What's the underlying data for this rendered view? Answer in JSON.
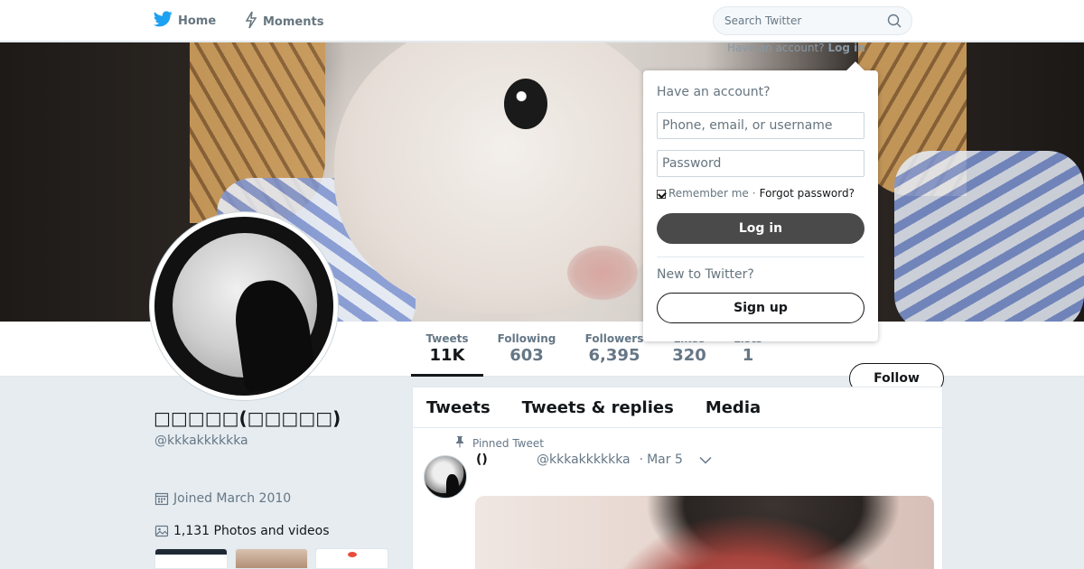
{
  "nav": {
    "home_label": "Home",
    "moments_label": "Moments",
    "search_placeholder": "Search Twitter",
    "account_prompt": "Have an account?",
    "login_link": "Log in"
  },
  "profile": {
    "display_name": "□□□□□(□□□□□)",
    "handle": "@kkkakkkkkka",
    "joined": "Joined March 2010",
    "photos_videos": "1,131 Photos and videos"
  },
  "stats": [
    {
      "label": "Tweets",
      "value": "11K"
    },
    {
      "label": "Following",
      "value": "603"
    },
    {
      "label": "Followers",
      "value": "6,395"
    },
    {
      "label": "Likes",
      "value": "320"
    },
    {
      "label": "Lists",
      "value": "1"
    }
  ],
  "follow_label": "Follow",
  "timeline": {
    "tabs": [
      "Tweets",
      "Tweets & replies",
      "Media"
    ],
    "pinned_label": "Pinned Tweet",
    "tweet": {
      "name": "()",
      "handle": "@kkkakkkkkka",
      "dot": "·",
      "date": "Mar 5"
    }
  },
  "login_card": {
    "title": "Have an account?",
    "username_placeholder": "Phone, email, or username",
    "password_placeholder": "Password",
    "remember_label": "Remember me",
    "separator": "·",
    "forgot_label": "Forgot password?",
    "login_button": "Log in",
    "new_prompt": "New to Twitter?",
    "signup_button": "Sign up"
  },
  "colors": {
    "twitter_blue": "#1da1f2",
    "text_primary": "#14171a",
    "text_secondary": "#657786",
    "login_button_bg": "#4a4a4a",
    "page_bg": "#e6ecf0"
  },
  "icons": [
    "twitter-bird-icon",
    "lightning-icon",
    "search-icon",
    "calendar-icon",
    "image-icon",
    "pin-icon",
    "chevron-down-icon"
  ]
}
